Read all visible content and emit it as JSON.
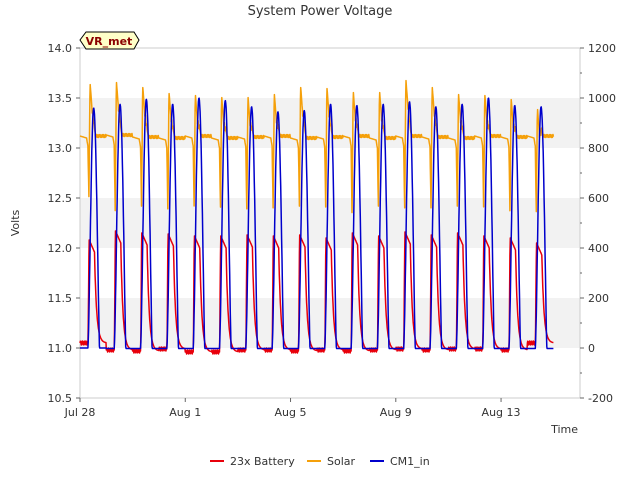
{
  "chart_data": {
    "type": "line",
    "title": "System Power Voltage",
    "xlabel": "Time",
    "ylabel": "Volts",
    "badge": "VR_met",
    "x_range": [
      "2021-07-28",
      "2021-08-16"
    ],
    "x_ticks": [
      {
        "date": "2021-07-28",
        "label": "Jul 28"
      },
      {
        "date": "2021-08-01",
        "label": "Aug 1"
      },
      {
        "date": "2021-08-05",
        "label": "Aug 5"
      },
      {
        "date": "2021-08-09",
        "label": "Aug 9"
      },
      {
        "date": "2021-08-13",
        "label": "Aug 13"
      }
    ],
    "y_left": {
      "lim": [
        10.5,
        14.0
      ],
      "ticks": [
        "10.5",
        "11.0",
        "11.5",
        "12.0",
        "12.5",
        "13.0",
        "13.5",
        "14.0"
      ]
    },
    "y_right": {
      "lim": [
        -200,
        1200
      ],
      "ticks": [
        "-200",
        "0",
        "200",
        "400",
        "600",
        "800",
        "1000",
        "1200"
      ]
    },
    "band_shading": true,
    "legend_position": "bottom-center",
    "series": [
      {
        "name": "23x Battery",
        "axis": "left",
        "color": "#e8000b",
        "first_day": "2021-07-28",
        "days": 18,
        "daily_min": [
          11.05,
          10.98,
          10.97,
          10.99,
          10.96,
          10.96,
          10.98,
          10.98,
          10.97,
          10.98,
          10.97,
          10.98,
          10.99,
          10.98,
          10.99,
          10.99,
          10.98,
          11.05
        ],
        "daily_max": [
          12.08,
          12.17,
          12.15,
          12.14,
          12.12,
          12.12,
          12.13,
          12.12,
          12.13,
          12.1,
          12.15,
          12.12,
          12.16,
          12.13,
          12.15,
          12.12,
          12.1,
          12.05
        ]
      },
      {
        "name": "Solar",
        "axis": "left",
        "color": "#f5a00a",
        "first_day": "2021-07-28",
        "days": 18,
        "daily_min": [
          12.48,
          12.33,
          12.38,
          12.35,
          12.38,
          12.37,
          12.35,
          12.36,
          12.38,
          12.37,
          12.31,
          12.38,
          12.36,
          12.36,
          12.38,
          12.37,
          12.33,
          12.32
        ],
        "daily_max": [
          13.66,
          13.68,
          13.63,
          13.57,
          13.55,
          13.53,
          13.53,
          13.56,
          13.63,
          13.62,
          13.58,
          13.58,
          13.7,
          13.63,
          13.56,
          13.55,
          13.51,
          13.41
        ],
        "daily_plateau": [
          13.12,
          13.13,
          13.11,
          13.1,
          13.12,
          13.1,
          13.11,
          13.12,
          13.1,
          13.11,
          13.12,
          13.1,
          13.12,
          13.11,
          13.1,
          13.12,
          13.11,
          13.12
        ]
      },
      {
        "name": "CM1_in",
        "axis": "right",
        "color": "#0000cc",
        "first_day": "2021-07-28",
        "days": 18,
        "daily_min": [
          0,
          -2,
          -2,
          -2,
          -2,
          -2,
          -2,
          -2,
          -2,
          -2,
          -2,
          -2,
          -2,
          -2,
          -2,
          -2,
          -2,
          -2
        ],
        "daily_max": [
          960,
          975,
          995,
          975,
          1000,
          990,
          965,
          945,
          950,
          975,
          970,
          975,
          985,
          965,
          975,
          1000,
          970,
          965
        ]
      }
    ]
  }
}
